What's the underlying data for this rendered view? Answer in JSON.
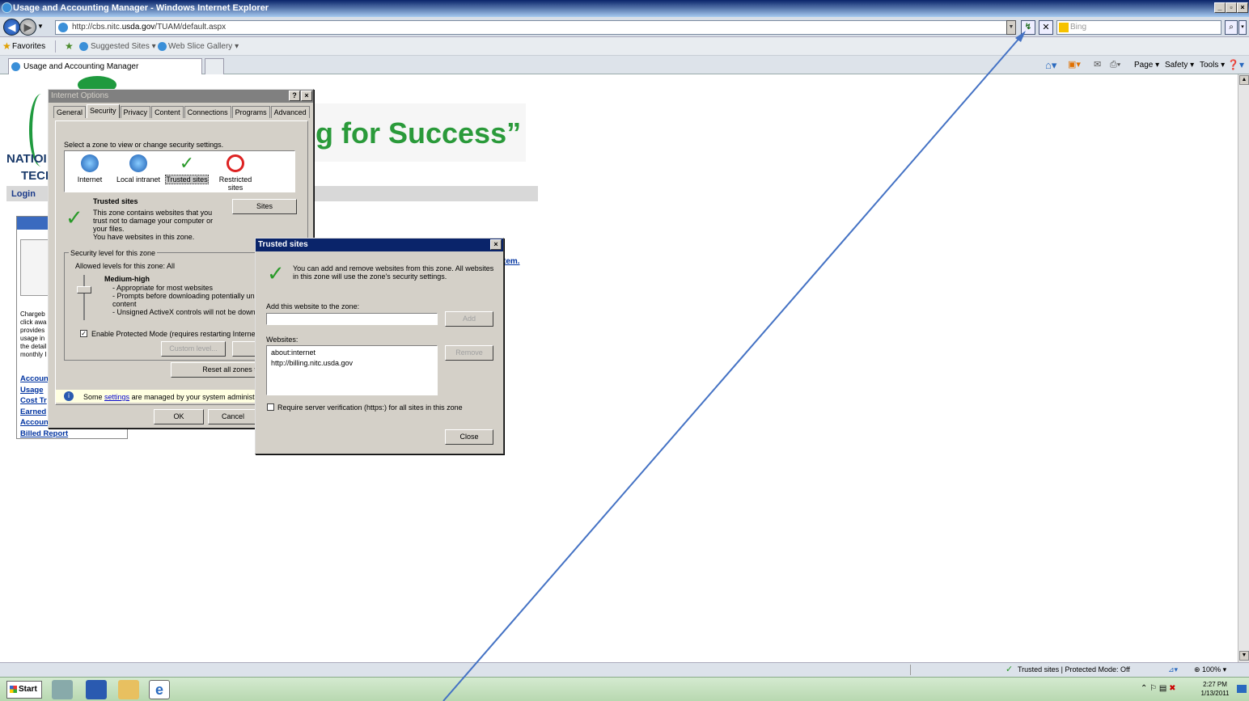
{
  "window": {
    "title": "Usage and Accounting Manager - Windows Internet Explorer"
  },
  "address": {
    "url_prefix": "http://cbs.nitc.",
    "url_domain": "usda.gov",
    "url_path": "/TUAM/default.aspx",
    "search_placeholder": "Bing"
  },
  "favorites": {
    "label": "Favorites",
    "suggested": "Suggested Sites ▾",
    "webslice": "Web Slice Gallery ▾"
  },
  "tab": {
    "label": "Usage and Accounting Manager"
  },
  "commands": {
    "page": "Page ▾",
    "safety": "Safety ▾",
    "tools": "Tools ▾"
  },
  "page": {
    "slogan": "g for Success”",
    "nation_text": "NATIOI",
    "tech_text": "TECH",
    "login_link": "Login",
    "desc_lines": [
      "Chargeb",
      "click awa",
      "provides",
      "usage in",
      "the detail",
      "monthly I"
    ],
    "links": [
      "Accoun",
      "Usage",
      "Cost Tr",
      "Earned",
      "Accoun",
      "Billed Report"
    ],
    "right_link": "tem."
  },
  "internet_options": {
    "title": "Internet Options",
    "tabs": [
      "General",
      "Security",
      "Privacy",
      "Content",
      "Connections",
      "Programs",
      "Advanced"
    ],
    "zone_prompt": "Select a zone to view or change security settings.",
    "zones": [
      "Internet",
      "Local intranet",
      "Trusted sites",
      "Restricted sites"
    ],
    "zone_name": "Trusted sites",
    "zone_desc": [
      "This zone contains websites that you",
      "trust not to damage your computer or",
      "your files.",
      "You have websites in this zone."
    ],
    "sites_button": "Sites",
    "security_level_group": "Security level for this zone",
    "allowed_levels": "Allowed levels for this zone: All",
    "level_name": "Medium-high",
    "level_desc": [
      "- Appropriate for most websites",
      "- Prompts before downloading potentially unsa",
      "content",
      "- Unsigned ActiveX controls will not be downloa"
    ],
    "protected_mode": "Enable Protected Mode (requires restarting Internet E",
    "custom_level": "Custom level...",
    "default_level": "Defa",
    "reset_all": "Reset all zones to defa",
    "settings_note_pre": "Some",
    "settings_link": "settings",
    "settings_note_post": "are managed by your system administrat",
    "ok": "OK",
    "cancel": "Cancel"
  },
  "trusted_sites": {
    "title": "Trusted sites",
    "info": "You can add and remove websites from this zone. All websites in this zone will use the zone's security settings.",
    "add_label": "Add this website to the zone:",
    "add_value": "",
    "add_button": "Add",
    "websites_label": "Websites:",
    "websites": [
      "about:internet",
      "http://billing.nitc.usda.gov"
    ],
    "remove_button": "Remove",
    "https_label": "Require server verification (https:) for all sites in this zone",
    "close_button": "Close"
  },
  "status": {
    "zone": "Trusted sites | Protected Mode: Off",
    "zoom": "100%"
  },
  "taskbar": {
    "start": "Start",
    "time": "2:27 PM",
    "date": "1/13/2011"
  },
  "annotation_color": "#4472c4"
}
